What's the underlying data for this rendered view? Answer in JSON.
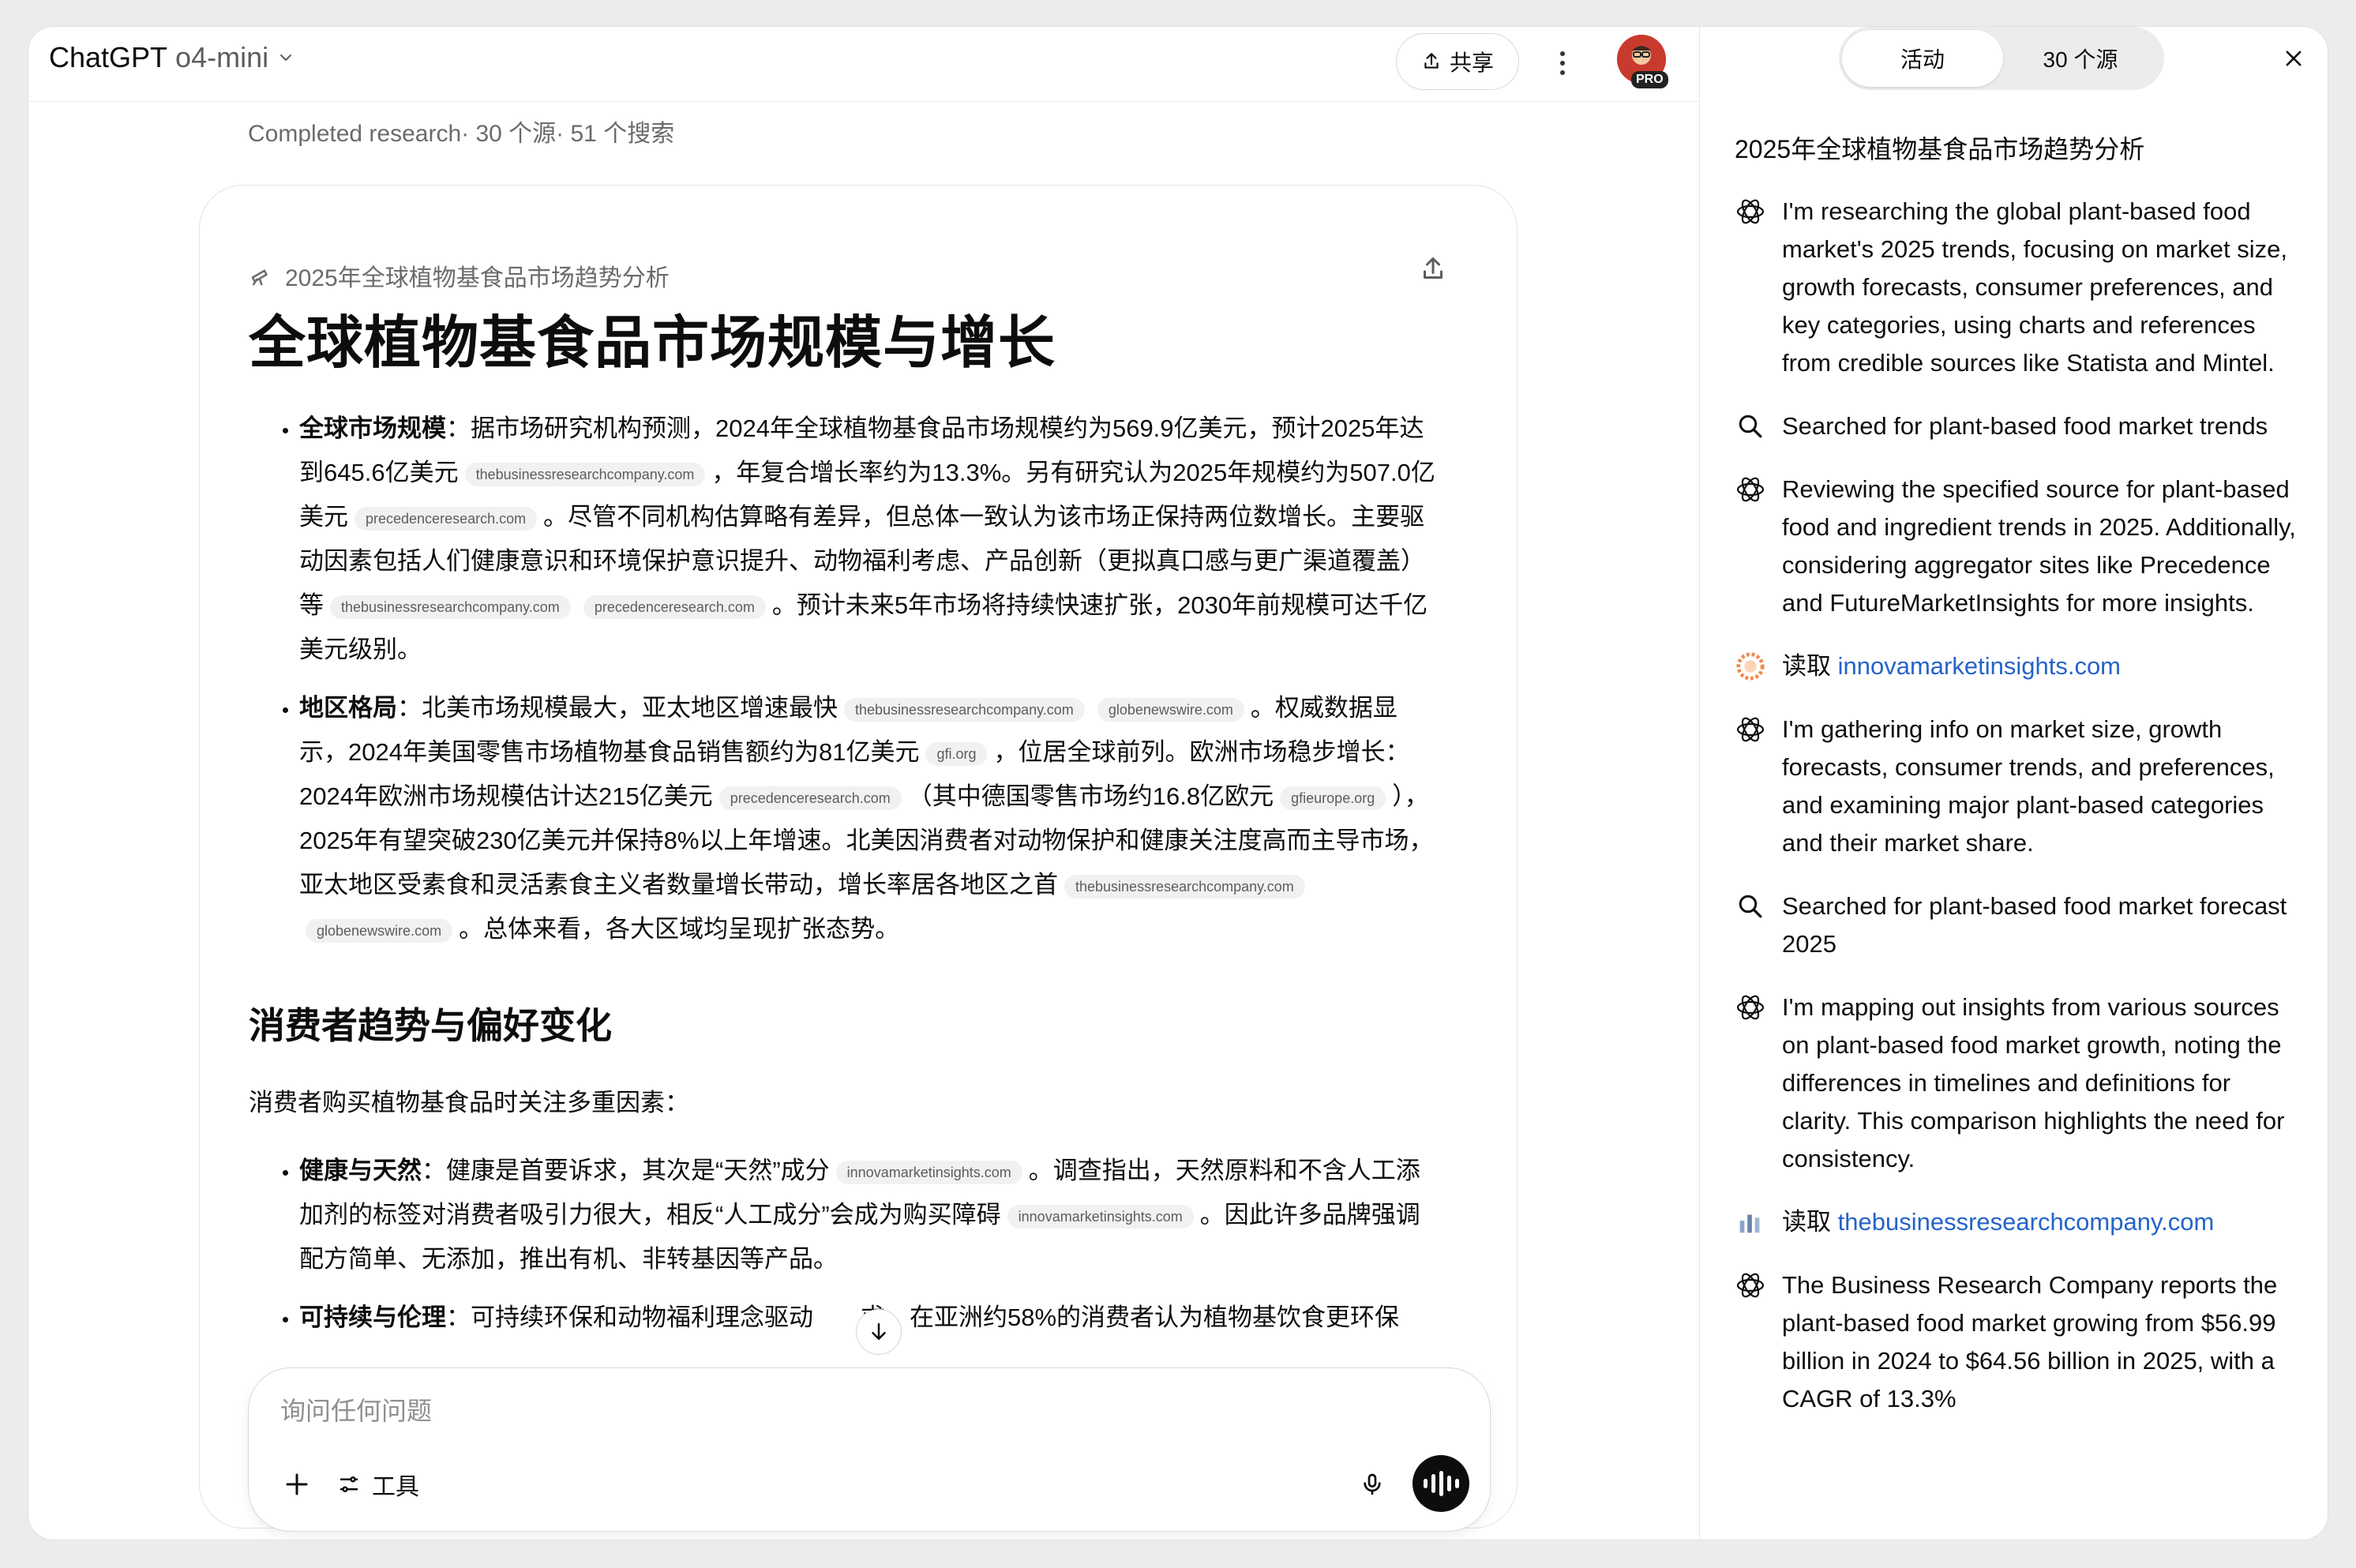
{
  "header": {
    "app_name": "ChatGPT",
    "model": "o4-mini",
    "share_label": "共享",
    "avatar_badge": "PRO"
  },
  "status_line": "Completed research· 30 个源· 51 个搜索",
  "card": {
    "header_label": "2025年全球植物基食品市场趋势分析",
    "title": "全球植物基食品市场规模与增长",
    "market_size": {
      "label": "全球市场规模",
      "t1": "：据市场研究机构预测，2024年全球植物基食品市场规模约为569.9亿美元，预计2025年达到645.6亿美元",
      "c1": "thebusinessresearchcompany.com",
      "t2": "，年复合增长率约为13.3%。另有研究认为2025年规模约为507.0亿美元",
      "c2": "precedenceresearch.com",
      "t3": "。尽管不同机构估算略有差异，但总体一致认为该市场正保持两位数增长。主要驱动因素包括人们健康意识和环境保护意识提升、动物福利考虑、产品创新（更拟真口感与更广渠道覆盖）等",
      "c3": "thebusinessresearchcompany.com",
      "c4": "precedenceresearch.com",
      "t4": "。预计未来5年市场将持续快速扩张，2030年前规模可达千亿美元级别。"
    },
    "regions": {
      "label": "地区格局",
      "t1": "：北美市场规模最大，亚太地区增速最快",
      "c1": "thebusinessresearchcompany.com",
      "c2": "globenewswire.com",
      "t2": "。权威数据显示，2024年美国零售市场植物基食品销售额约为81亿美元",
      "c3": "gfi.org",
      "t3": "，位居全球前列。欧洲市场稳步增长：2024年欧洲市场规模估计达215亿美元",
      "c4": "precedenceresearch.com",
      "t4": "（其中德国零售市场约16.8亿欧元",
      "c5": "gfieurope.org",
      "t5": "），2025年有望突破230亿美元并保持8%以上年增速。北美因消费者对动物保护和健康关注度高而主导市场，亚太地区受素食和灵活素食主义者数量增长带动，增长率居各地区之首",
      "c6": "thebusinessresearchcompany.com",
      "c7": "globenewswire.com",
      "t6": "。总体来看，各大区域均呈现扩张态势。"
    },
    "section2_title": "消费者趋势与偏好变化",
    "section2_intro": "消费者购买植物基食品时关注多重因素：",
    "health": {
      "label": "健康与天然",
      "t1": "：健康是首要诉求，其次是“天然”成分",
      "c1": "innovamarketinsights.com",
      "t2": "。调查指出，天然原料和不含人工添加剂的标签对消费者吸引力很大，相反“人工成分”会成为购买障碍",
      "c2": "innovamarketinsights.com",
      "t3": "。因此许多品牌强调配方简单、无添加，推出有机、非转基因等产品。"
    },
    "sustain": {
      "label": "可持续与伦理",
      "t1": "：可持续环保和动物福利理念驱动",
      "t2": "求。在亚洲约58%的消费者认为植物基饮食更环保"
    }
  },
  "composer": {
    "placeholder": "询问任何问题",
    "tools_label": "工具"
  },
  "side": {
    "tab_active": "活动",
    "tab_sources": "30 个源",
    "title": "2025年全球植物基食品市场趋势分析",
    "items": [
      {
        "icon": "openai-icon",
        "text": "I'm researching the global plant-based food market's 2025 trends, focusing on market size, growth forecasts, consumer preferences, and key categories, using charts and references from credible sources like Statista and Mintel."
      },
      {
        "icon": "search-icon",
        "text": "Searched for plant-based food market trends"
      },
      {
        "icon": "openai-icon",
        "text": "Reviewing the specified source for plant-based food and ingredient trends in 2025. Additionally, considering aggregator sites like Precedence and FutureMarketInsights for more insights."
      },
      {
        "icon": "innova-favicon",
        "prefix": "读取",
        "link": "innovamarketinsights.com"
      },
      {
        "icon": "openai-icon",
        "text": "I'm gathering info on market size, growth forecasts, consumer trends, and preferences, and examining major plant-based categories and their market share."
      },
      {
        "icon": "search-icon",
        "text": "Searched for plant-based food market forecast 2025"
      },
      {
        "icon": "openai-icon",
        "text": "I'm mapping out insights from various sources on plant-based food market growth, noting the differences in timelines and definitions for clarity. This comparison highlights the need for consistency."
      },
      {
        "icon": "tbrc-favicon",
        "prefix": "读取",
        "link": "thebusinessresearchcompany.com"
      },
      {
        "icon": "openai-icon",
        "text": "The Business Research Company reports the plant-based food market growing from $56.99 billion in 2024 to $64.56 billion in 2025, with a CAGR of 13.3%"
      }
    ]
  }
}
